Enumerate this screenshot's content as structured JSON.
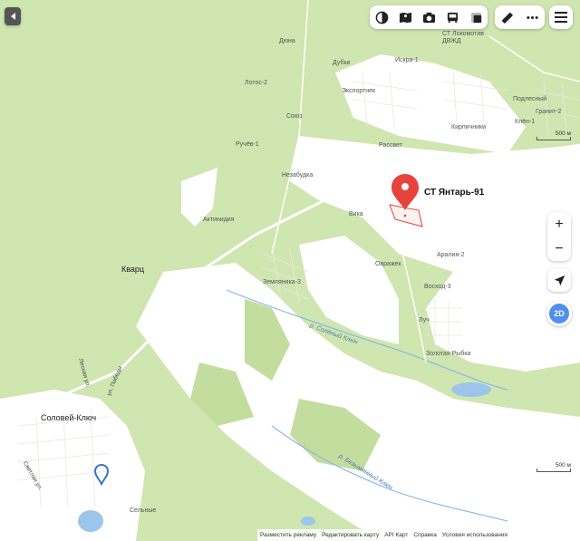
{
  "map": {
    "place_labels": {
      "dyatlov": "Дюна",
      "dubki": "Дубки",
      "iskra": "Искра-1",
      "lotos": "Лотос-2",
      "ekspress": "Экспортнек",
      "soyuz": "Союз",
      "ruchey": "Ручёв-1",
      "nezabudka": "Незабудка",
      "rassvet": "Рассвет",
      "aktinidia": "Актинидия",
      "vika": "Вика",
      "kvarts": "Кварц",
      "zemlyanika": "Земляника-3",
      "ovrazhek": "Овражек",
      "aralia": "Аралия-2",
      "voskhod": "Восход-3",
      "luch": "Луч",
      "zolotaya": "Золотая Рыбка",
      "solovey": "Соловей-Ключ",
      "selnye": "Сельные",
      "st_top": "СТ Локомотив ДВЖД",
      "kirpichniki": "Кирпичники",
      "podlesnyi": "Подлесный",
      "klen": "Клён-1",
      "granit": "Гранит-2"
    },
    "river_labels": {
      "solenyi": "р. Солёный Ключ",
      "bezymyannyi": "р. Безымянный Ключ"
    },
    "street_labels": {
      "lesnaya": "Лесная ул.",
      "pobedy": "ул. Победы",
      "svetlaya": "Светлая ул."
    },
    "marker": {
      "title": "СТ Янтарь-91",
      "color": "#e8433a"
    }
  },
  "toolbar": {
    "layers_icon": "layers-icon",
    "panorama_icon": "panorama-icon",
    "camera_icon": "camera-icon",
    "transport_icon": "transport-icon",
    "traffic_icon": "traffic-icon",
    "ruler_icon": "ruler-icon",
    "more_icon": "more-icon",
    "menu_icon": "menu-icon"
  },
  "controls": {
    "zoom_in": "+",
    "zoom_out": "−",
    "mode_2d": "2D"
  },
  "scale": {
    "label": "500 м"
  },
  "attribution": {
    "ads": "Разместить рекламу",
    "edit": "Редактировать карту",
    "api": "API Карт",
    "help": "Справка",
    "terms": "Условия использования"
  },
  "colors": {
    "forest": "#c9e3a6",
    "field": "#ffffff",
    "water": "#9cc5ec",
    "road": "#ffffff",
    "accent": "#4f8ff0"
  }
}
